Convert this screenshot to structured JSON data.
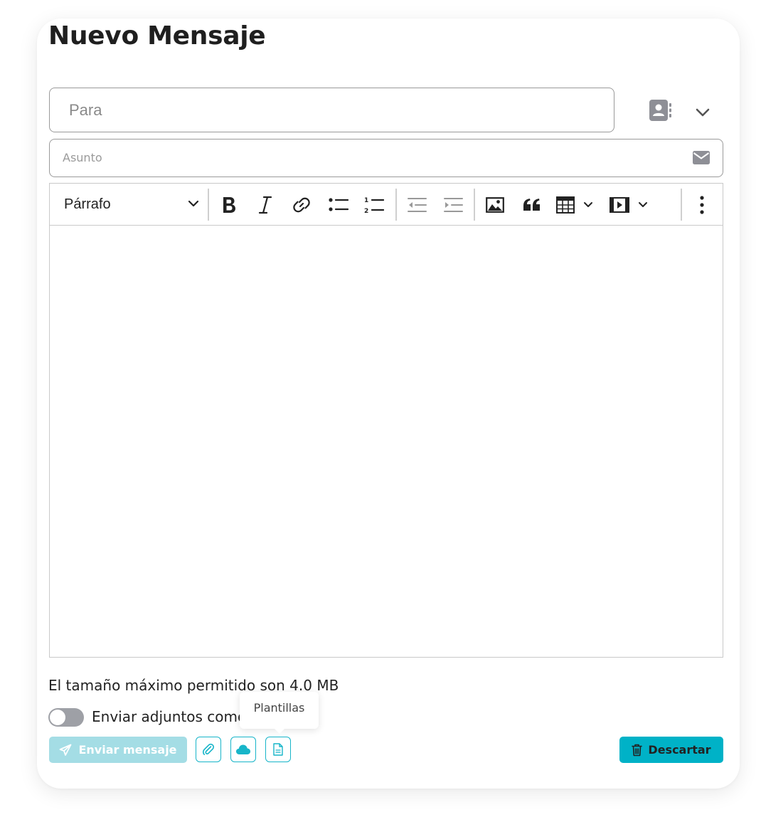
{
  "page": {
    "title": "Nuevo Mensaje"
  },
  "to_field": {
    "placeholder": "Para",
    "value": ""
  },
  "subject_field": {
    "placeholder": "Asunto",
    "value": ""
  },
  "toolbar": {
    "block_format": "Párrafo",
    "buttons": [
      "bold-icon",
      "italic-icon",
      "link-icon",
      "bullet-list-icon",
      "numbered-list-icon",
      "outdent-icon",
      "indent-icon",
      "image-icon",
      "quote-icon",
      "table-icon",
      "media-icon",
      "more-vertical-icon"
    ]
  },
  "editor": {
    "content": ""
  },
  "footer": {
    "size_note": "El tamaño máximo permitido son 4.0 MB",
    "toggle_label": "Enviar adjuntos como enlace",
    "toggle_on": false,
    "tooltip": "Plantillas",
    "send_label": "Enviar mensaje",
    "discard_label": "Descartar"
  },
  "colors": {
    "accent": "#00b2c7",
    "accent_disabled": "#a4dde5",
    "icon_gray": "#8e8f96",
    "border": "#9a9a9a",
    "text": "#222222"
  }
}
